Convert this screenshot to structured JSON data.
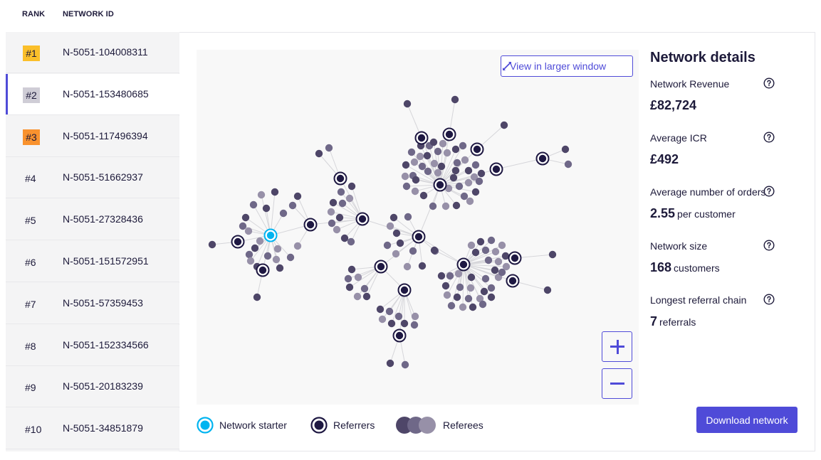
{
  "table_header": {
    "rank": "RANK",
    "network_id": "NETWORK ID"
  },
  "networks": [
    {
      "rank": "#1",
      "id": "N-5051-104008311",
      "badge": "gold"
    },
    {
      "rank": "#2",
      "id": "N-5051-153480685",
      "badge": "silver",
      "selected": true
    },
    {
      "rank": "#3",
      "id": "N-5051-117496394",
      "badge": "bronze"
    },
    {
      "rank": "#4",
      "id": "N-5051-51662937",
      "badge": "plain"
    },
    {
      "rank": "#5",
      "id": "N-5051-27328436",
      "badge": "plain"
    },
    {
      "rank": "#6",
      "id": "N-5051-151572951",
      "badge": "plain"
    },
    {
      "rank": "#7",
      "id": "N-5051-57359453",
      "badge": "plain"
    },
    {
      "rank": "#8",
      "id": "N-5051-152334566",
      "badge": "plain"
    },
    {
      "rank": "#9",
      "id": "N-5051-20183239",
      "badge": "plain"
    },
    {
      "rank": "#10",
      "id": "N-5051-34851879",
      "badge": "plain"
    }
  ],
  "graph": {
    "view_larger_label": "View in larger window",
    "zoom_in_icon": "plus-icon",
    "zoom_out_icon": "minus-icon"
  },
  "legend": {
    "starter": "Network starter",
    "referrers": "Referrers",
    "referees": "Referees"
  },
  "details": {
    "title": "Network details",
    "metrics": [
      {
        "label": "Network Revenue",
        "value": "£82,724",
        "unit": ""
      },
      {
        "label": "Average ICR",
        "value": "£492",
        "unit": ""
      },
      {
        "label": "Average number of orders",
        "value": "2.55",
        "unit": "per customer"
      },
      {
        "label": "Network size",
        "value": "168",
        "unit": "customers"
      },
      {
        "label": "Longest referral chain",
        "value": "7",
        "unit": "referrals"
      }
    ],
    "download_label": "Download network"
  },
  "colors": {
    "accent": "#4f4bd8",
    "starter": "#00b4f0",
    "referrer": "#1e1842",
    "referee_dark": "#4e4668",
    "referee_mid": "#6f6888",
    "referee_light": "#9790a8",
    "gold": "#fbbf2a",
    "silver": "#cfcdd6",
    "bronze": "#f9922e"
  }
}
